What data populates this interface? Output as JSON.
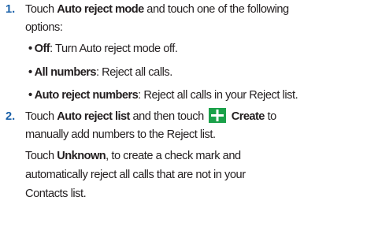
{
  "steps": [
    {
      "number": "1.",
      "line1": {
        "pre": "Touch ",
        "b1": "Auto reject mode",
        "post": " and touch one of the following"
      },
      "line2": "options:",
      "bullets": [
        {
          "symbol": "•",
          "term": "Off",
          "text": ": Turn Auto reject mode off."
        },
        {
          "symbol": "•",
          "term": "All numbers",
          "text": ": Reject all calls."
        },
        {
          "symbol": "•",
          "term": "Auto reject numbers",
          "text": ": Reject all calls in your Reject list."
        }
      ]
    },
    {
      "number": "2.",
      "line1": {
        "pre": "Touch ",
        "b1": "Auto reject list",
        "mid": " and then touch",
        "b2": "Create",
        "post": " to"
      },
      "line2": "manually add numbers to the Reject list.",
      "para": {
        "l1_pre": "Touch ",
        "l1_b": "Unknown",
        "l1_post": ", to create a check mark and",
        "l2": "automatically reject all calls that are not in your",
        "l3": "Contacts list."
      }
    }
  ],
  "icons": {
    "create": "plus-icon",
    "create_color": "#1ba14a"
  },
  "colors": {
    "step_number": "#1a60a8",
    "text": "#231f20"
  }
}
